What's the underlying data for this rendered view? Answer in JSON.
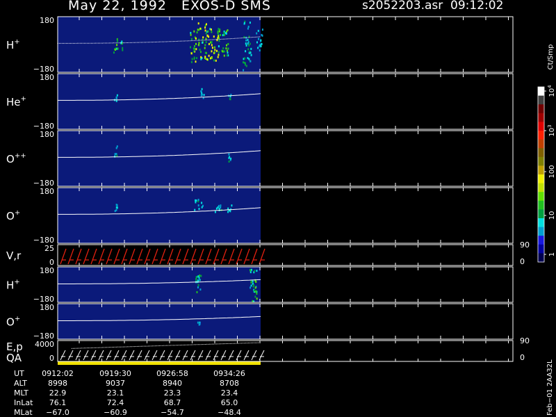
{
  "header": {
    "title": "May 22, 1992   EXOS-D SMS",
    "file": "s2052203.asr  09:12:02"
  },
  "chart_data": {
    "type": "heatmap",
    "panels": [
      {
        "id": "h-plus",
        "label": "H",
        "sup": "+",
        "ytick_top": "180",
        "ytick_bottom": "−180"
      },
      {
        "id": "he-plus",
        "label": "He",
        "sup": "+",
        "ytick_top": "180",
        "ytick_bottom": "−180"
      },
      {
        "id": "o-pp",
        "label": "O",
        "sup": "++",
        "ytick_top": "180",
        "ytick_bottom": "−180"
      },
      {
        "id": "o-plus",
        "label": "O",
        "sup": "+",
        "ytick_top": "180",
        "ytick_bottom": "−180"
      },
      {
        "id": "vr",
        "label": "V,r",
        "ytick_top": "25",
        "ytick_bottom": "0",
        "right_top": "90",
        "right_bottom": "0"
      },
      {
        "id": "h-plus-2",
        "label": "H",
        "sup": "+",
        "ytick_top": "180",
        "ytick_bottom": "−180"
      },
      {
        "id": "o-plus-2",
        "label": "O",
        "sup": "+",
        "ytick_top": "180",
        "ytick_bottom": "−180"
      },
      {
        "id": "ep",
        "label": "E,p",
        "label2": "QA",
        "ytick_top": "4000",
        "ytick_bottom": "0",
        "right_top": "90",
        "right_bottom": "0"
      }
    ],
    "colorbar": {
      "unit": "Ct/Smp",
      "tick_labels": [
        "1",
        "10",
        "100",
        "10",
        "10"
      ],
      "tick_sups": [
        "",
        "",
        "",
        "3",
        "4"
      ],
      "colors": [
        "#000050",
        "#0000a0",
        "#1818e0",
        "#00a0d0",
        "#00e0e0",
        "#00a040",
        "#20c020",
        "#60e000",
        "#c0e000",
        "#f0f000",
        "#c0a000",
        "#808000",
        "#806000",
        "#c04000",
        "#ff2000",
        "#e00000",
        "#a00000",
        "#700000",
        "#404040",
        "#ffffff"
      ]
    },
    "x_axis": {
      "row_labels": [
        "UT",
        "ALT",
        "MLT",
        "InLat",
        "MLat"
      ],
      "columns": [
        [
          "0912:02",
          "8998",
          "22.9",
          "76.1",
          "−67.0"
        ],
        [
          "0919:30",
          "9037",
          "23.1",
          "72.4",
          "−60.9"
        ],
        [
          "0926:58",
          "8940",
          "23.3",
          "68.7",
          "−54.7"
        ],
        [
          "0934:26",
          "8708",
          "23.4",
          "65.0",
          "−48.4"
        ]
      ]
    },
    "side_label": "Feb−01 2AA32L"
  }
}
